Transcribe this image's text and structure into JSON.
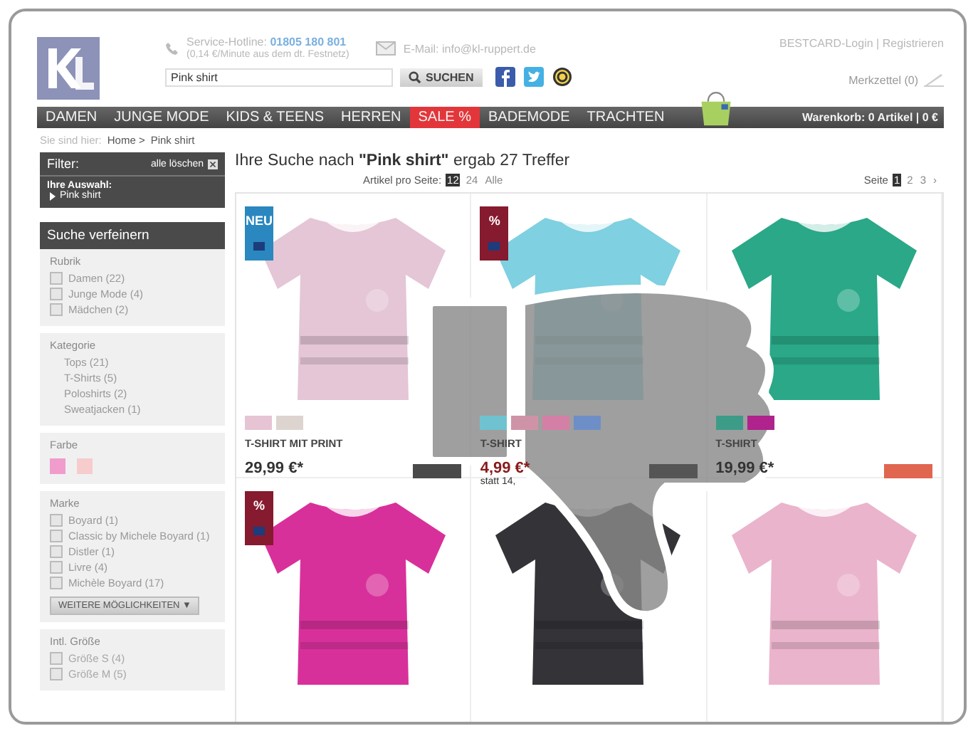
{
  "header": {
    "hotline_label": "Service-Hotline:",
    "hotline_number": "01805 180 801",
    "hotline_note": "(0,14 €/Minute aus dem dt. Festnetz)",
    "email": "E-Mail: info@kl-ruppert.de",
    "login": "BESTCARD-Login",
    "separator": "|",
    "register": "Registrieren",
    "search": {
      "value": "Pink shirt",
      "button": "SUCHEN"
    },
    "wishlist": "Merkzettel (0)"
  },
  "nav": [
    {
      "label": "DAMEN",
      "highlight": false
    },
    {
      "label": "JUNGE MODE",
      "highlight": false
    },
    {
      "label": "KIDS & TEENS",
      "highlight": false
    },
    {
      "label": "HERREN",
      "highlight": false
    },
    {
      "label": "SALE %",
      "highlight": true
    },
    {
      "label": "BADEMODE",
      "highlight": false
    },
    {
      "label": "TRACHTEN",
      "highlight": false
    }
  ],
  "cart": "Warenkorb: 0 Artikel | 0 €",
  "breadcrumb": {
    "prefix": "Sie sind hier:",
    "items": [
      "Home >",
      "Pink shirt"
    ]
  },
  "filter": {
    "title": "Filter:",
    "clear": "alle löschen",
    "selection_title": "Ihre Auswahl:",
    "selection": [
      "Pink shirt"
    ]
  },
  "refine": {
    "title": "Suche verfeinern",
    "sections": [
      {
        "title": "Rubrik",
        "kind": "checkboxes",
        "items": [
          {
            "label": "Damen (22)",
            "checked": false
          },
          {
            "label": "Junge Mode (4)",
            "checked": false
          },
          {
            "label": "Mädchen (2)",
            "checked": false
          }
        ]
      },
      {
        "title": "Kategorie",
        "kind": "links",
        "items": [
          {
            "label": "Tops (21)"
          },
          {
            "label": "T-Shirts (5)"
          },
          {
            "label": "Poloshirts (2)"
          },
          {
            "label": "Sweatjacken (1)"
          }
        ]
      },
      {
        "title": "Farbe",
        "kind": "colors",
        "items": [
          {
            "color": "#f09ccc"
          },
          {
            "color": "#f6cccc"
          }
        ]
      },
      {
        "title": "Marke",
        "kind": "checkboxes",
        "items": [
          {
            "label": "Boyard (1)",
            "checked": false
          },
          {
            "label": "Classic by Michele Boyard (1)",
            "checked": false
          },
          {
            "label": "Distler (1)",
            "checked": false
          },
          {
            "label": "Livre (4)",
            "checked": false
          },
          {
            "label": "Michèle Boyard (17)",
            "checked": false
          }
        ],
        "more": {
          "label": "WEITERE MÖGLICHKEITEN",
          "caret": "▼"
        }
      },
      {
        "title": "Intl. Größe",
        "kind": "checkboxes",
        "disabled": true,
        "items": [
          {
            "label": "Größe S (4)",
            "checked": false
          },
          {
            "label": "Größe M (5)",
            "checked": false
          }
        ]
      }
    ]
  },
  "results": {
    "title_prefix": "Ihre Suche nach ",
    "query": "\"Pink shirt\"",
    "title_suffix": " ergab 27 Treffer",
    "per_page_label": "Artikel pro Seite:",
    "per_page": [
      {
        "label": "12",
        "selected": true
      },
      {
        "label": "24",
        "selected": false
      },
      {
        "label": "Alle",
        "selected": false
      }
    ],
    "page_label": "Seite",
    "pages": [
      {
        "label": "1",
        "selected": true
      },
      {
        "label": "2",
        "selected": false
      },
      {
        "label": "3",
        "selected": false
      }
    ],
    "next": "›"
  },
  "products": [
    {
      "picture": {
        "kind": "picture"
      },
      "tag": {
        "text": "NEU",
        "color": "#2a87bf"
      },
      "swatches": [
        {
          "color": "#e6c4d4"
        },
        {
          "color": "#ddd4d0"
        }
      ],
      "name": "T-SHIRT MIT PRINT",
      "price": "29,99 €*",
      "sale": false,
      "brand": {
        "color": "#4a4a4a"
      }
    },
    {
      "picture": {
        "kind": "picture"
      },
      "tag": {
        "text": "%",
        "color": "#861a2e"
      },
      "swatches": [
        {
          "color": "#6fc3d0"
        },
        {
          "color": "#cf93a8"
        },
        {
          "color": "#d47fa6"
        },
        {
          "color": "#6e8ec8"
        }
      ],
      "name": "T-SHIRT",
      "price": "4,99 €*",
      "old_price": "statt 14,",
      "sale": true,
      "brand": {
        "color": "#555555"
      }
    },
    {
      "picture": {
        "kind": "picture"
      },
      "swatches": [
        {
          "color": "#3c9c88"
        },
        {
          "color": "#b0228c"
        }
      ],
      "name": "T-SHIRT",
      "price": "19,99 €*",
      "sale": false,
      "brand": {
        "color": "#e06650"
      }
    },
    {
      "picture": {
        "kind": "picture"
      },
      "tag": {
        "text": "%",
        "color": "#861a2e"
      }
    },
    {
      "picture": {
        "kind": "picture"
      }
    },
    {
      "picture": {
        "kind": "picture"
      }
    }
  ]
}
